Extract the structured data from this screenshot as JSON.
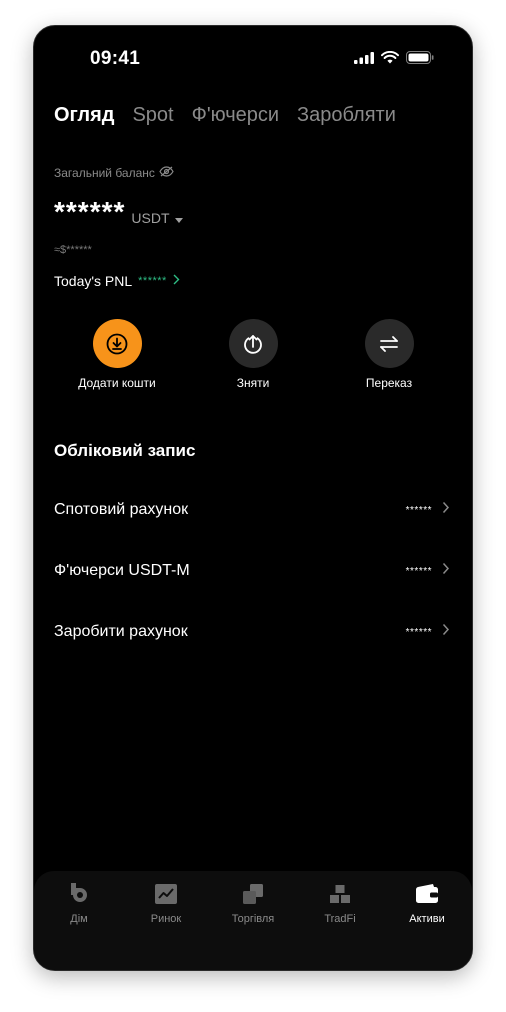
{
  "status_bar": {
    "time": "09:41"
  },
  "tabs": [
    {
      "label": "Огляд",
      "active": true
    },
    {
      "label": "Spot",
      "active": false
    },
    {
      "label": "Ф'ючерси",
      "active": false
    },
    {
      "label": "Заробляти",
      "active": false
    }
  ],
  "balance": {
    "label": "Загальний баланс",
    "value": "******",
    "currency": "USDT",
    "approx": "≈$******"
  },
  "pnl": {
    "label": "Today's PNL",
    "value": "******"
  },
  "actions": [
    {
      "label": "Додати кошти",
      "icon": "deposit-icon"
    },
    {
      "label": "Зняти",
      "icon": "withdraw-icon"
    },
    {
      "label": "Переказ",
      "icon": "transfer-icon"
    }
  ],
  "accounts": {
    "title": "Обліковий запис",
    "items": [
      {
        "name": "Спотовий рахунок",
        "value": "******"
      },
      {
        "name": "Ф'ючерси USDT-M",
        "value": "******"
      },
      {
        "name": "Заробити рахунок",
        "value": "******"
      }
    ]
  },
  "nav": [
    {
      "label": "Дім",
      "icon": "home-logo-icon",
      "active": false
    },
    {
      "label": "Ринок",
      "icon": "market-chart-icon",
      "active": false
    },
    {
      "label": "Торгівля",
      "icon": "trade-icon",
      "active": false
    },
    {
      "label": "TradFi",
      "icon": "tradfi-bars-icon",
      "active": false
    },
    {
      "label": "Активи",
      "icon": "wallet-icon",
      "active": true
    }
  ],
  "colors": {
    "background": "#000000",
    "accent": "#f7931a",
    "positive": "#2ebd85",
    "muted_text": "#8a8a8a"
  }
}
